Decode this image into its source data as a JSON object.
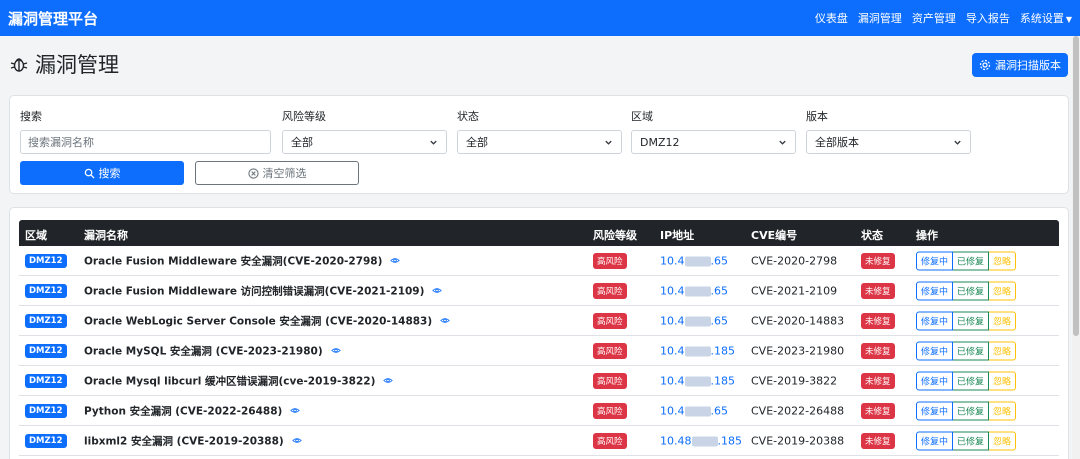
{
  "navbar": {
    "brand": "漏洞管理平台",
    "items": [
      "仪表盘",
      "漏洞管理",
      "资产管理",
      "导入报告",
      "系统设置"
    ]
  },
  "page": {
    "title": "漏洞管理",
    "scan_button": "漏洞扫描版本"
  },
  "filters": {
    "search_label": "搜索",
    "search_placeholder": "搜索漏洞名称",
    "risk_label": "风险等级",
    "risk_value": "全部",
    "status_label": "状态",
    "status_value": "全部",
    "zone_label": "区域",
    "zone_value": "DMZ12",
    "version_label": "版本",
    "version_value": "全部版本",
    "search_button": "搜索",
    "clear_button": "清空筛选"
  },
  "table": {
    "headers": [
      "区域",
      "漏洞名称",
      "风险等级",
      "IP地址",
      "CVE编号",
      "状态",
      "操作"
    ],
    "actions": [
      "修复中",
      "已修复",
      "忽略"
    ],
    "rows": [
      {
        "zone": "DMZ12",
        "name": "Oracle Fusion Middleware 安全漏洞(CVE-2020-2798)",
        "risk": "高风险",
        "ip_prefix": "10.4",
        "ip_suffix": ".65",
        "cve": "CVE-2020-2798",
        "status": "未修复"
      },
      {
        "zone": "DMZ12",
        "name": "Oracle Fusion Middleware 访问控制错误漏洞(CVE-2021-2109)",
        "risk": "高风险",
        "ip_prefix": "10.4",
        "ip_suffix": ".65",
        "cve": "CVE-2021-2109",
        "status": "未修复"
      },
      {
        "zone": "DMZ12",
        "name": "Oracle WebLogic Server Console 安全漏洞 (CVE-2020-14883)",
        "risk": "高风险",
        "ip_prefix": "10.4",
        "ip_suffix": ".65",
        "cve": "CVE-2020-14883",
        "status": "未修复"
      },
      {
        "zone": "DMZ12",
        "name": "Oracle MySQL 安全漏洞 (CVE-2023-21980)",
        "risk": "高风险",
        "ip_prefix": "10.4",
        "ip_suffix": ".185",
        "cve": "CVE-2023-21980",
        "status": "未修复"
      },
      {
        "zone": "DMZ12",
        "name": "Oracle Mysql libcurl 缓冲区错误漏洞(cve-2019-3822)",
        "risk": "高风险",
        "ip_prefix": "10.4",
        "ip_suffix": ".185",
        "cve": "CVE-2019-3822",
        "status": "未修复"
      },
      {
        "zone": "DMZ12",
        "name": "Python 安全漏洞 (CVE-2022-26488)",
        "risk": "高风险",
        "ip_prefix": "10.4",
        "ip_suffix": ".65",
        "cve": "CVE-2022-26488",
        "status": "未修复"
      },
      {
        "zone": "DMZ12",
        "name": "libxml2 安全漏洞 (CVE-2019-20388)",
        "risk": "高风险",
        "ip_prefix": "10.48",
        "ip_suffix": ".185",
        "cve": "CVE-2019-20388",
        "status": "未修复"
      }
    ]
  },
  "colors": {
    "primary": "#0d6efd",
    "danger": "#dc3545",
    "success": "#198754",
    "warning": "#ffc107",
    "dark": "#212529"
  }
}
